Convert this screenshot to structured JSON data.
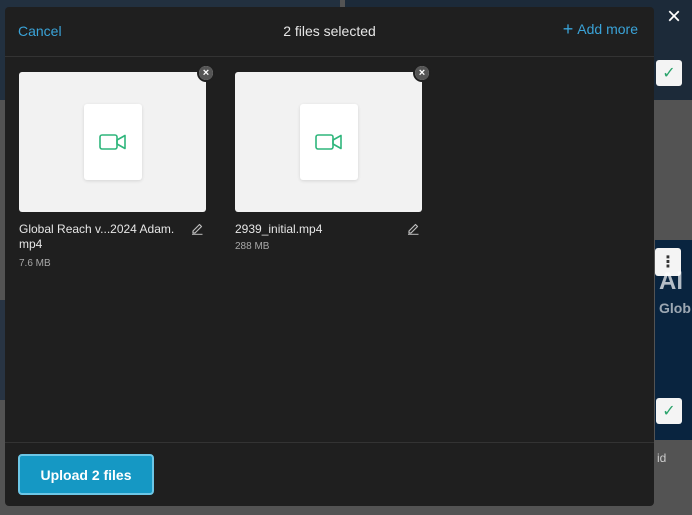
{
  "background": {
    "text_fragments": [
      "Al",
      "Glob",
      "id"
    ]
  },
  "header": {
    "cancel_label": "Cancel",
    "title": "2 files selected",
    "add_more_plus": "+",
    "add_more_label": "Add more"
  },
  "files": [
    {
      "name": "Global Reach v...2024 Adam.mp4",
      "size": "7.6 MB",
      "icon": "video-camera-icon"
    },
    {
      "name": "2939_initial.mp4",
      "size": "288 MB",
      "icon": "video-camera-icon"
    }
  ],
  "footer": {
    "upload_label": "Upload 2 files"
  },
  "icons": {
    "close": "×",
    "remove": "×",
    "check": "✓",
    "kebab": "⋮"
  },
  "colors": {
    "accent": "#3aa3d8",
    "upload_button": "#1598c4",
    "video_icon": "#2fb67c"
  }
}
